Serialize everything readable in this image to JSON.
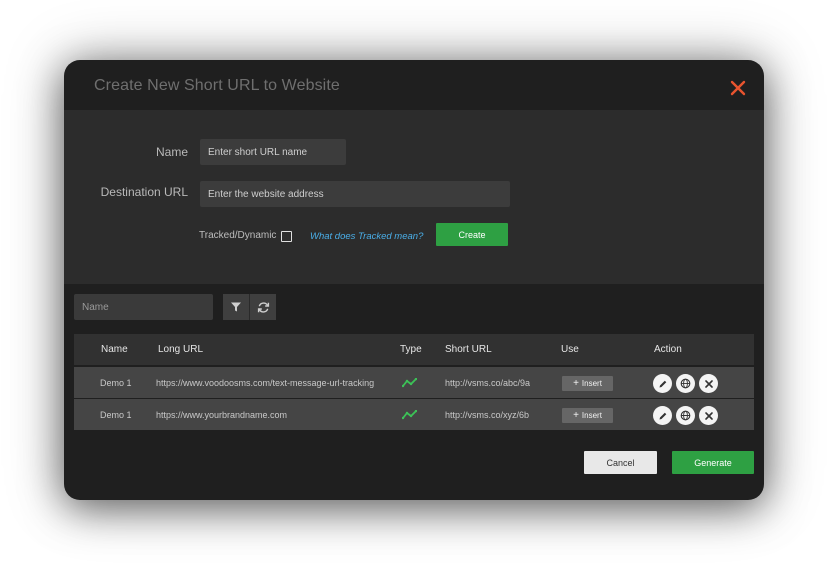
{
  "dialog": {
    "title": "Create New Short URL to Website",
    "close_icon": "close-icon",
    "accent": "#e8542f"
  },
  "form": {
    "name_label": "Name",
    "name_placeholder": "Enter short URL name",
    "destination_label": "Destination URL",
    "destination_placeholder": "Enter the website address",
    "tracked_label": "Tracked/Dynamic",
    "tracked_checked": false,
    "help_link": "What does Tracked mean?",
    "create_label": "Create"
  },
  "toolbar": {
    "filter_placeholder": "Name",
    "filter_icon": "filter-icon",
    "refresh_icon": "refresh-icon"
  },
  "table": {
    "headers": {
      "name": "Name",
      "long_url": "Long URL",
      "type": "Type",
      "short_url": "Short URL",
      "use": "Use",
      "action": "Action"
    },
    "rows": [
      {
        "name": "Demo 1",
        "long_url": "https://www.voodoosms.com/text-message-url-tracking",
        "type_icon": "tracked-trend-icon",
        "short_url": "http://vsms.co/abc/9a",
        "insert_label": "Insert"
      },
      {
        "name": "Demo 1",
        "long_url": "https://www.yourbrandname.com",
        "type_icon": "tracked-trend-icon",
        "short_url": "http://vsms.co/xyz/6b",
        "insert_label": "Insert"
      }
    ]
  },
  "footer": {
    "cancel_label": "Cancel",
    "generate_label": "Generate"
  },
  "colors": {
    "primary_green": "#2ea043",
    "link_blue": "#4aaee8",
    "dialog_bg": "#1f1f1f",
    "panel_bg": "#2c2c2c"
  }
}
